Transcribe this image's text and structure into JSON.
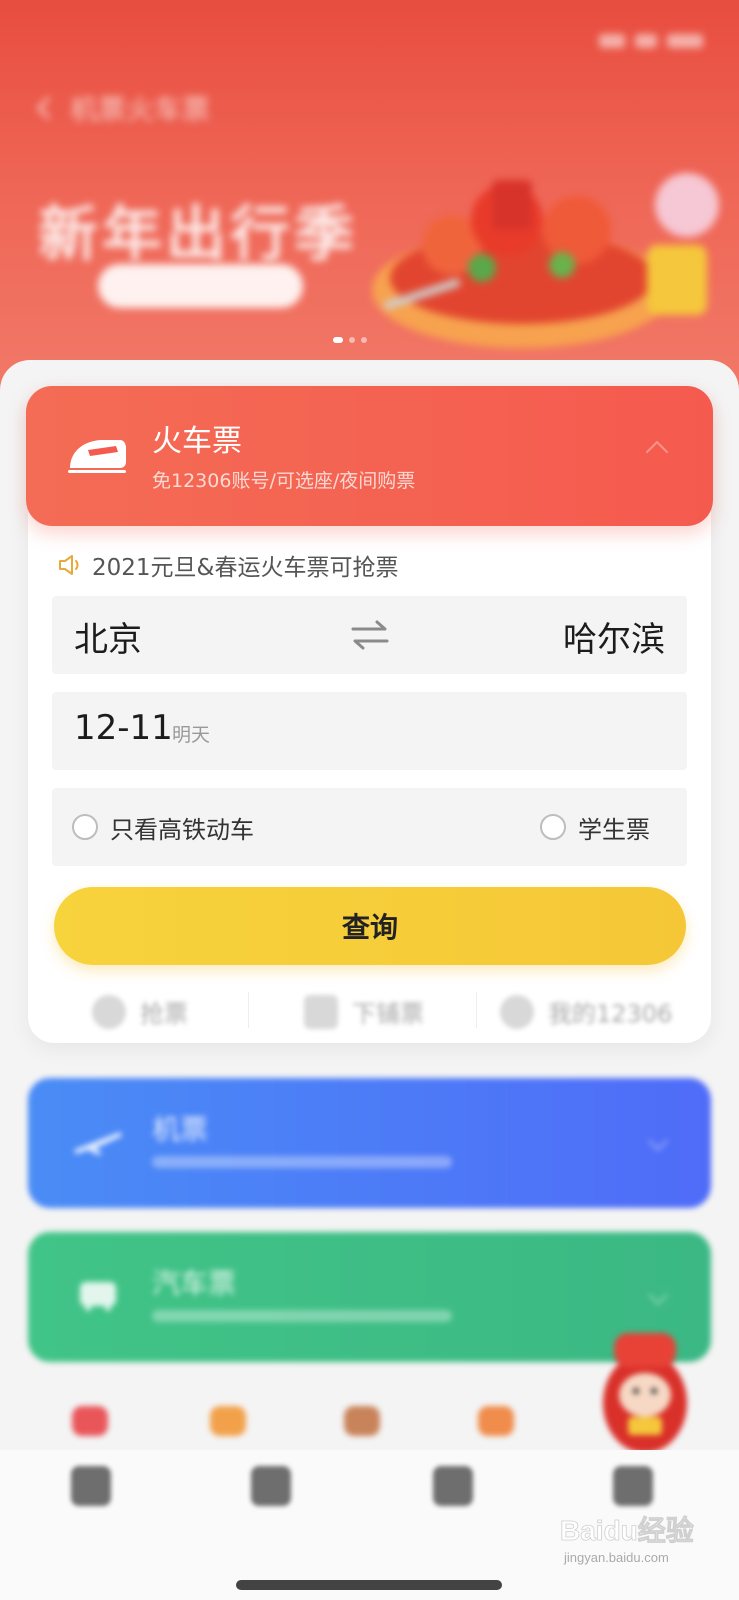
{
  "status_bar": {
    "time": ""
  },
  "header": {
    "nav_title": "机票火车票",
    "banner_title": "新年出行季",
    "banner_button": "",
    "banner_page_count": 3,
    "banner_active_page": 1
  },
  "train_card": {
    "title": "火车票",
    "subtitle": "免12306账号/可选座/夜间购票",
    "notice": "2021元旦&春运火车票可抢票",
    "from_city": "北京",
    "to_city": "哈尔滨",
    "date": "12-11",
    "date_hint": "明天",
    "option_high_speed": "只看高铁动车",
    "option_student": "学生票",
    "query_button": "查询",
    "quick_links": [
      {
        "label": "抢票",
        "icon": "grab-ticket-icon"
      },
      {
        "label": "下铺票",
        "icon": "lower-berth-icon"
      },
      {
        "label": "我的12306",
        "icon": "my-12306-icon"
      }
    ]
  },
  "flight_card": {
    "title": "机票"
  },
  "bus_card": {
    "title": "汽车票"
  },
  "tabbar": {
    "tabs": [
      {
        "label": "",
        "icon": "home-icon"
      },
      {
        "label": "",
        "icon": "trip-icon"
      },
      {
        "label": "",
        "icon": "service-icon"
      },
      {
        "label": "",
        "icon": "profile-icon"
      }
    ]
  },
  "watermark": {
    "text": "Baidu经验",
    "sub": "jingyan.baidu.com"
  },
  "colors": {
    "train_accent": "#f55a4e",
    "query_button": "#f5c737",
    "flight_card": "#4f6cf8",
    "bus_card": "#3bb884",
    "hero_bg": "#e84d3f"
  }
}
